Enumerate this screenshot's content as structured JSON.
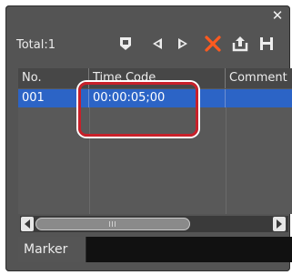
{
  "panel": {
    "total_label": "Total:1"
  },
  "toolbar": {
    "icons": [
      "marker-down-icon",
      "previous-icon",
      "next-icon",
      "delete-icon",
      "export-icon",
      "save-icon"
    ]
  },
  "list": {
    "columns": [
      "No.",
      "Time Code",
      "Comment"
    ],
    "rows": [
      {
        "no": "001",
        "timecode": "00:00:05;00",
        "comment": ""
      }
    ]
  },
  "tabs": {
    "marker": "Marker"
  },
  "colors": {
    "selection": "#2c64c6",
    "delete": "#ff5a1f",
    "highlight": "#c8202a"
  }
}
